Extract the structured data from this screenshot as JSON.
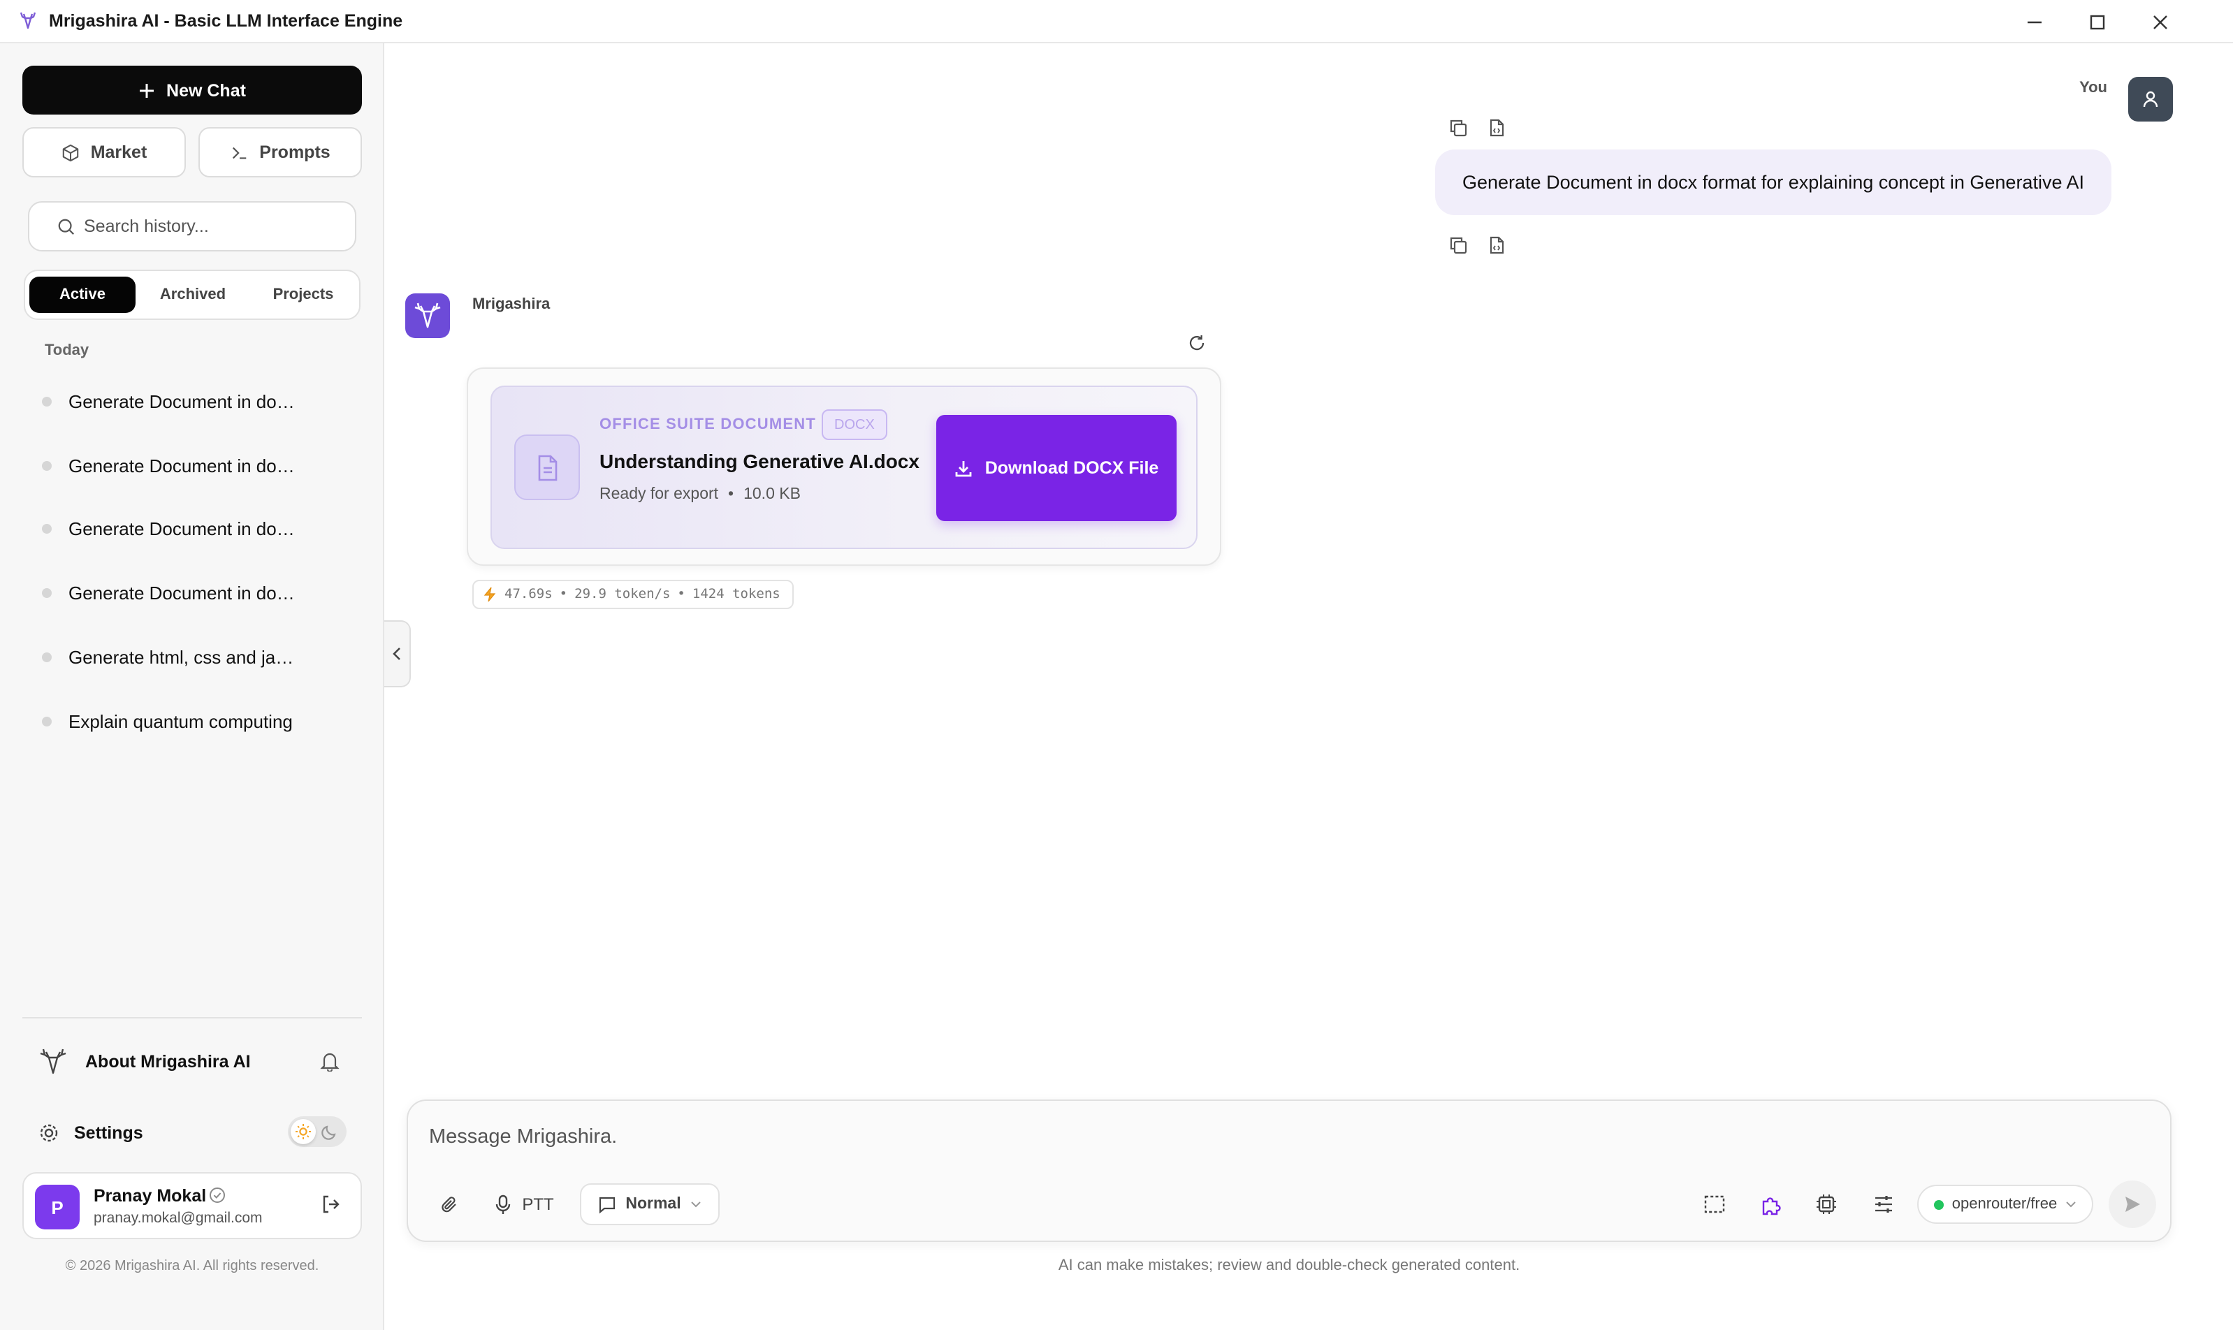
{
  "window": {
    "title": "Mrigashira AI - Basic LLM Interface Engine",
    "controls": [
      "minimize-icon",
      "maximize-icon",
      "close-icon"
    ]
  },
  "sidebar": {
    "new_chat_label": "New Chat",
    "market_label": "Market",
    "prompts_label": "Prompts",
    "search_placeholder": "Search history...",
    "tabs": [
      "Active",
      "Archived",
      "Projects"
    ],
    "active_tab": "Active",
    "section_label": "Today",
    "history": [
      "Generate Document in docx format for explaining concept in Generative AI",
      "Generate Document in docx format for explaining concept in Generative AI",
      "Generate Document in docx format for explaining concept in Generative AI",
      "Generate Document in docx format for explaining concept in Generative AI",
      "Generate html, css and javascript code",
      "Explain quantum computing"
    ],
    "about_label": "About Mrigashira AI",
    "settings_label": "Settings",
    "theme": "light",
    "user": {
      "initial": "P",
      "name": "Pranay Mokal",
      "email": "pranay.mokal@gmail.com"
    },
    "copyright": "© 2026 Mrigashira AI. All rights reserved."
  },
  "chat": {
    "user_label": "You",
    "user_message": "Generate Document in docx format for explaining concept in Generative AI",
    "assistant_name": "Mrigashira",
    "document": {
      "kind": "OFFICE SUITE DOCUMENT",
      "badge": "DOCX",
      "filename": "Understanding Generative AI.docx",
      "status": "Ready for export",
      "separator": "•",
      "size": "10.0 KB",
      "download_label": "Download DOCX File"
    },
    "stats": {
      "time": "47.69s",
      "speed": "29.9 token/s",
      "tokens": "1424 tokens",
      "separator": "•"
    }
  },
  "composer": {
    "placeholder": "Message Mrigashira.",
    "ptt_label": "PTT",
    "mode_label": "Normal",
    "model_label": "openrouter/free",
    "disclaimer": "AI can make mistakes; review and double-check generated content."
  },
  "colors": {
    "accent": "#7a24e6",
    "user_bubble": "#f1eefa",
    "status_dot": "#22c55e"
  }
}
